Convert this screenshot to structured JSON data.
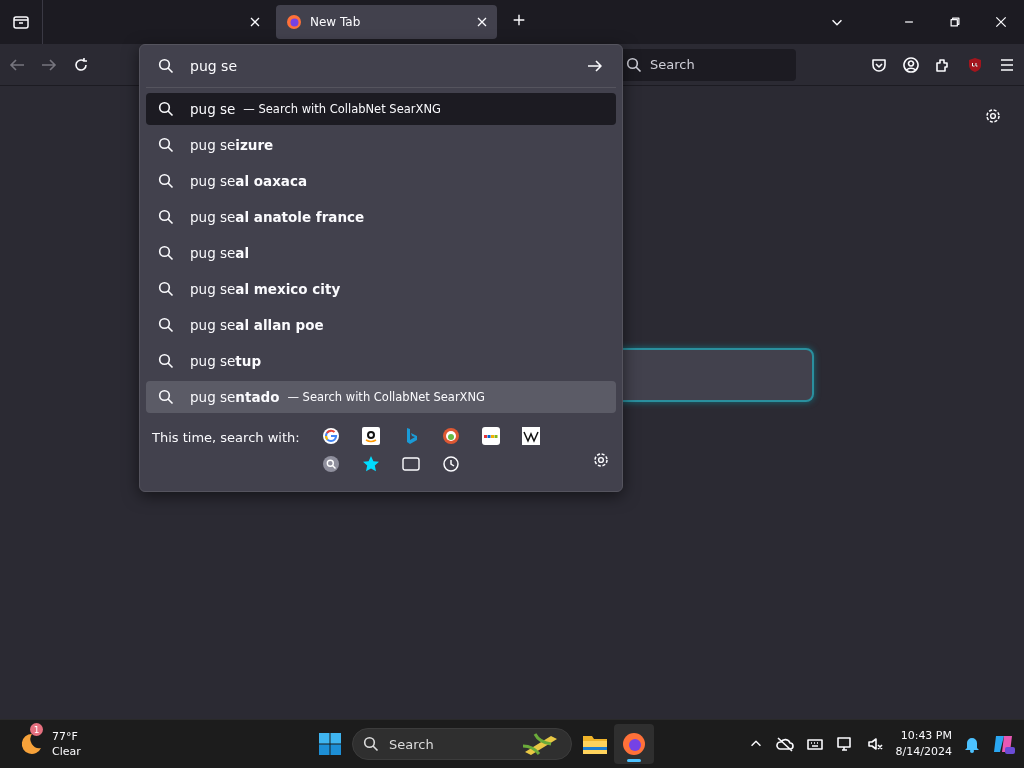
{
  "tabs": [
    {
      "selected": false
    },
    {
      "label": "New Tab",
      "selected": true
    }
  ],
  "url_bar": {
    "value": "pug se"
  },
  "search_bar": {
    "placeholder": "Search"
  },
  "suggestions": [
    {
      "kind": "heuristic",
      "text": "pug se",
      "action": "— Search with CollabNet SearXNG",
      "selected": false
    },
    {
      "kind": "suggestion",
      "text": "pug se**izure**",
      "selected": false
    },
    {
      "kind": "suggestion",
      "text": "pug se**al oaxaca**",
      "selected": false
    },
    {
      "kind": "suggestion",
      "text": "pug se**al anatole france**",
      "selected": false
    },
    {
      "kind": "suggestion",
      "text": "pug se**al**",
      "selected": false
    },
    {
      "kind": "suggestion",
      "text": "pug se**al mexico city**",
      "selected": false
    },
    {
      "kind": "suggestion",
      "text": "pug se**al allan poe**",
      "selected": false
    },
    {
      "kind": "suggestion",
      "text": "pug se**tup**",
      "selected": false
    },
    {
      "kind": "suggestion",
      "text": "pug se**ntado**",
      "action": "— Search with CollabNet SearXNG",
      "selected": true
    }
  ],
  "one_off": {
    "label": "This time, search with:"
  },
  "taskbar": {
    "weather": {
      "badge": "1",
      "temp": "77°F",
      "condition": "Clear"
    },
    "search_placeholder": "Search",
    "time": "10:43 PM",
    "date": "8/14/2024"
  }
}
